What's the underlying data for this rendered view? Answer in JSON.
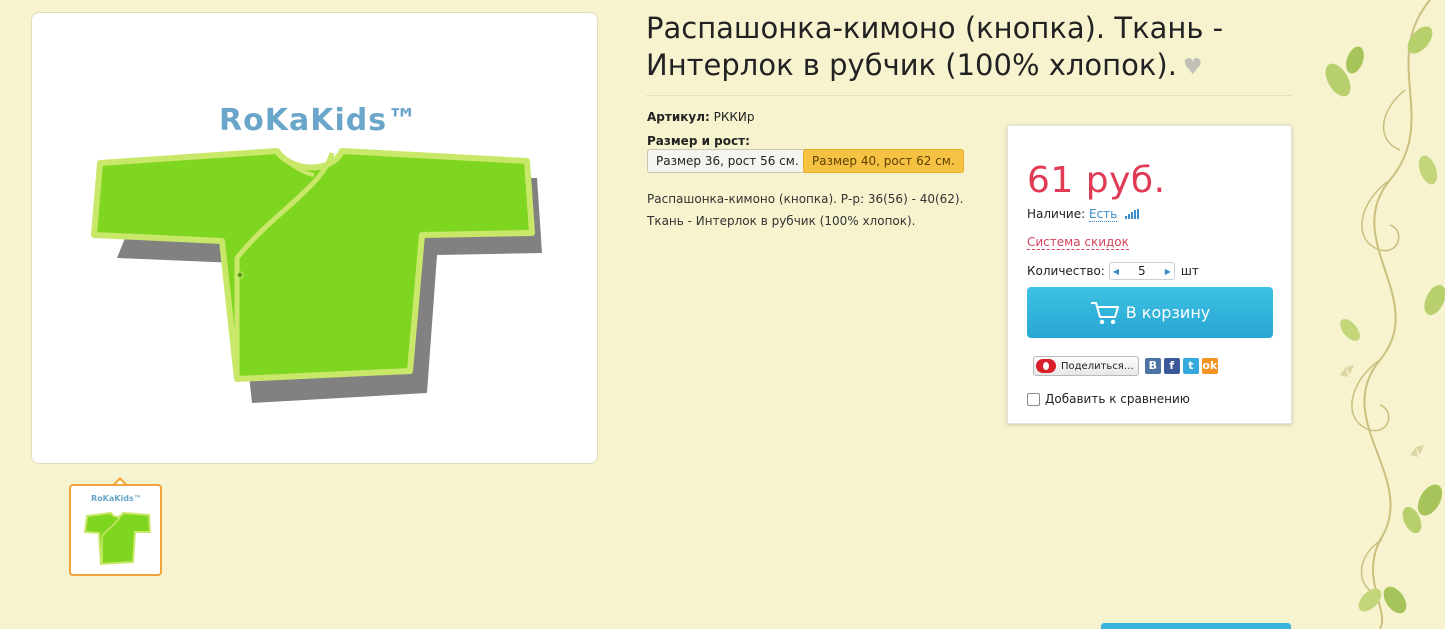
{
  "product": {
    "title": "Распашонка-кимоно (кнопка). Ткань - Интерлок в рубчик (100% хлопок).",
    "sku_label": "Артикул:",
    "sku_value": "РККИр",
    "size_label": "Размер и рост:",
    "sizes": [
      "Размер 36, рост 56 см.",
      "Размер 40, рост 62 см."
    ],
    "selected_size_index": 1,
    "description_line1": "Распашонка-кимоно (кнопка). Р-р: 36(56) - 40(62).",
    "description_line2": "Ткань - Интерлок в рубчик (100% хлопок).",
    "image_brand": "RoKaKids™"
  },
  "buybox": {
    "price": "61 руб.",
    "availability_label": "Наличие:",
    "availability_value": "Есть",
    "discount_link": "Система скидок",
    "qty_label": "Количество:",
    "qty_value": "5",
    "qty_unit": "шт",
    "cart_button": "В корзину",
    "share_label": "Поделиться…",
    "social": [
      "В",
      "f",
      "t",
      "ok"
    ],
    "compare_label": "Добавить к сравнению"
  },
  "colors": {
    "background": "#f8f3cf",
    "price": "#e03a54",
    "cart_button": "#2eb2dc",
    "selected_size": "#f6c244",
    "thumb_border": "#f1a33b",
    "product": "#7fd620"
  },
  "icons": [
    "heart-icon",
    "signal-icon",
    "cart-icon",
    "stepper-decrease-icon",
    "stepper-increase-icon"
  ]
}
